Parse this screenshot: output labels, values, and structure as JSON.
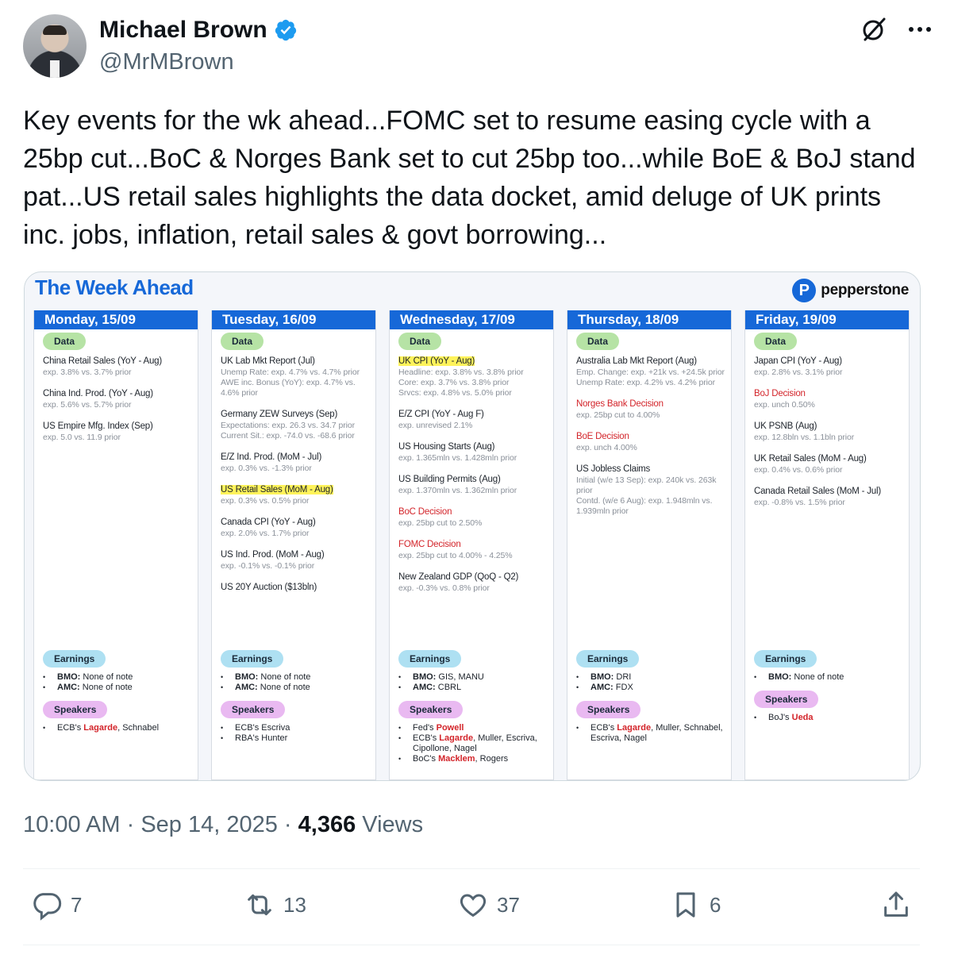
{
  "author": {
    "name": "Michael Brown",
    "handle": "@MrMBrown"
  },
  "tweet": {
    "text": "Key events for the wk ahead...FOMC set to resume easing cycle with a 25bp cut...BoC & Norges Bank set to cut 25bp too...while BoE & BoJ stand pat...US retail sales highlights the data docket, amid deluge of UK prints inc. jobs, inflation, retail sales & govt borrowing..."
  },
  "card": {
    "title": "The Week Ahead",
    "brand": "pepperstone",
    "brand_mark": "P",
    "labels": {
      "data": "Data",
      "earnings": "Earnings",
      "speakers": "Speakers"
    },
    "days": [
      {
        "header": "Monday, 15/09",
        "events": [
          {
            "title": "China Retail Sales (YoY - Aug)",
            "exp": "exp. 3.8% vs. 3.7% prior"
          },
          {
            "title": "China Ind. Prod. (YoY - Aug)",
            "exp": "exp. 5.6% vs. 5.7% prior"
          },
          {
            "title": "US Empire Mfg. Index (Sep)",
            "exp": "exp. 5.0 vs. 11.9 prior"
          }
        ],
        "earnings": [
          {
            "k": "BMO:",
            "v": " None of note"
          },
          {
            "k": "AMC:",
            "v": " None of note"
          }
        ],
        "speakers": [
          {
            "pre": "ECB's ",
            "hl": "Lagarde",
            "post": ", Schnabel"
          }
        ]
      },
      {
        "header": "Tuesday, 16/09",
        "events": [
          {
            "title": "UK Lab Mkt Report (Jul)",
            "exp": "Unemp Rate: exp. 4.7% vs. 4.7% prior\nAWE inc. Bonus (YoY): exp. 4.7% vs. 4.6% prior"
          },
          {
            "title": "Germany ZEW Surveys (Sep)",
            "exp": "Expectations: exp. 26.3 vs. 34.7 prior\nCurrent Sit.: exp. -74.0 vs. -68.6 prior"
          },
          {
            "title": "E/Z Ind. Prod. (MoM - Jul)",
            "exp": "exp. 0.3% vs. -1.3% prior"
          },
          {
            "title": "US Retail Sales (MoM - Aug)",
            "exp": "exp. 0.3% vs. 0.5% prior",
            "style": "hl"
          },
          {
            "title": "Canada CPI (YoY - Aug)",
            "exp": "exp. 2.0% vs. 1.7% prior"
          },
          {
            "title": "US Ind. Prod. (MoM - Aug)",
            "exp": "exp. -0.1% vs. -0.1% prior"
          },
          {
            "title": "US 20Y Auction ($13bln)",
            "exp": ""
          }
        ],
        "earnings": [
          {
            "k": "BMO:",
            "v": " None of note"
          },
          {
            "k": "AMC:",
            "v": " None of note"
          }
        ],
        "speakers": [
          {
            "pre": "ECB's Escriva",
            "hl": "",
            "post": ""
          },
          {
            "pre": "RBA's Hunter",
            "hl": "",
            "post": ""
          }
        ]
      },
      {
        "header": "Wednesday, 17/09",
        "events": [
          {
            "title": "UK CPI (YoY - Aug)",
            "exp": "Headline: exp. 3.8% vs. 3.8% prior\nCore: exp. 3.7% vs. 3.8% prior\nSrvcs: exp. 4.8% vs. 5.0% prior",
            "style": "hl"
          },
          {
            "title": "E/Z CPI (YoY - Aug F)",
            "exp": "exp. unrevised 2.1%"
          },
          {
            "title": "US Housing Starts (Aug)",
            "exp": "exp. 1.365mln vs. 1.428mln prior"
          },
          {
            "title": "US Building Permits (Aug)",
            "exp": "exp. 1.370mln vs. 1.362mln prior"
          },
          {
            "title": "BoC Decision",
            "exp": "exp. 25bp cut to 2.50%",
            "style": "red"
          },
          {
            "title": "FOMC Decision",
            "exp": "exp. 25bp cut to 4.00% - 4.25%",
            "style": "red"
          },
          {
            "title": "New Zealand GDP (QoQ - Q2)",
            "exp": "exp. -0.3% vs. 0.8% prior"
          }
        ],
        "earnings": [
          {
            "k": "BMO:",
            "v": " GIS, MANU"
          },
          {
            "k": "AMC:",
            "v": " CBRL"
          }
        ],
        "speakers": [
          {
            "pre": "Fed's ",
            "hl": "Powell",
            "post": ""
          },
          {
            "pre": "ECB's ",
            "hl": "Lagarde",
            "post": ", Muller, Escriva, Cipollone, Nagel"
          },
          {
            "pre": "BoC's ",
            "hl": "Macklem",
            "post": ", Rogers"
          }
        ]
      },
      {
        "header": "Thursday, 18/09",
        "events": [
          {
            "title": "Australia Lab Mkt Report (Aug)",
            "exp": "Emp. Change: exp. +21k vs. +24.5k prior\nUnemp Rate: exp. 4.2% vs. 4.2% prior"
          },
          {
            "title": "Norges Bank Decision",
            "exp": "exp. 25bp cut to 4.00%",
            "style": "red"
          },
          {
            "title": "BoE Decision",
            "exp": "exp. unch 4.00%",
            "style": "red"
          },
          {
            "title": "US Jobless Claims",
            "exp": "Initial (w/e 13 Sep): exp. 240k vs. 263k prior\nContd. (w/e 6 Aug): exp. 1.948mln vs. 1.939mln prior"
          }
        ],
        "earnings": [
          {
            "k": "BMO:",
            "v": " DRI"
          },
          {
            "k": "AMC:",
            "v": " FDX"
          }
        ],
        "speakers": [
          {
            "pre": "ECB's ",
            "hl": "Lagarde",
            "post": ", Muller, Schnabel, Escriva, Nagel"
          }
        ]
      },
      {
        "header": "Friday, 19/09",
        "events": [
          {
            "title": "Japan CPI (YoY - Aug)",
            "exp": "exp. 2.8% vs. 3.1% prior"
          },
          {
            "title": "BoJ Decision",
            "exp": "exp. unch 0.50%",
            "style": "red"
          },
          {
            "title": "UK PSNB (Aug)",
            "exp": "exp. 12.8bln vs. 1.1bln prior"
          },
          {
            "title": "UK Retail Sales (MoM - Aug)",
            "exp": "exp. 0.4% vs. 0.6% prior"
          },
          {
            "title": "Canada Retail Sales (MoM - Jul)",
            "exp": "exp. -0.8% vs. 1.5% prior"
          }
        ],
        "earnings": [
          {
            "k": "BMO:",
            "v": " None of note"
          }
        ],
        "speakers": [
          {
            "pre": "BoJ's ",
            "hl": "Ueda",
            "post": ""
          }
        ]
      }
    ]
  },
  "meta": {
    "time": "10:00 AM",
    "date": "Sep 14, 2025",
    "sep": " · ",
    "views_count": "4,366",
    "views_label": "Views"
  },
  "actions": {
    "replies": "7",
    "reposts": "13",
    "likes": "37",
    "bookmarks": "6"
  },
  "colors": {
    "accent": "#1668d8",
    "verified": "#1d9bf0",
    "red": "#d3242a",
    "highlight": "#fff35a"
  }
}
